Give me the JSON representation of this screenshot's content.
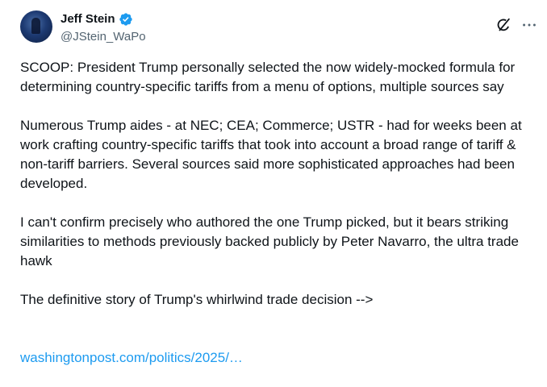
{
  "author": {
    "display_name": "Jeff Stein",
    "handle": "@JStein_WaPo",
    "verified_icon": "verified-badge-icon",
    "avatar_icon": "avatar"
  },
  "actions": {
    "grok_icon": "grok-icon",
    "more_icon": "more-icon"
  },
  "tweet": {
    "paragraphs": [
      "SCOOP: President Trump personally selected the now widely-mocked formula for determining country-specific tariffs from a menu of options, multiple sources say",
      "Numerous Trump aides - at NEC; CEA; Commerce; USTR - had for weeks been at work crafting country-specific tariffs that took into account a broad range of tariff & non-tariff barriers. Several sources said more sophisticated approaches had been developed.",
      "I can't confirm precisely who authored the one Trump picked, but it bears striking similarities to methods previously backed publicly by Peter Navarro, the ultra trade hawk",
      "The definitive story of Trump's whirlwind trade decision -->"
    ],
    "link_text": "washingtonpost.com/politics/2025/…"
  },
  "colors": {
    "text": "#0f1419",
    "secondary": "#536471",
    "link": "#1d9bf0",
    "verified": "#1d9bf0"
  }
}
